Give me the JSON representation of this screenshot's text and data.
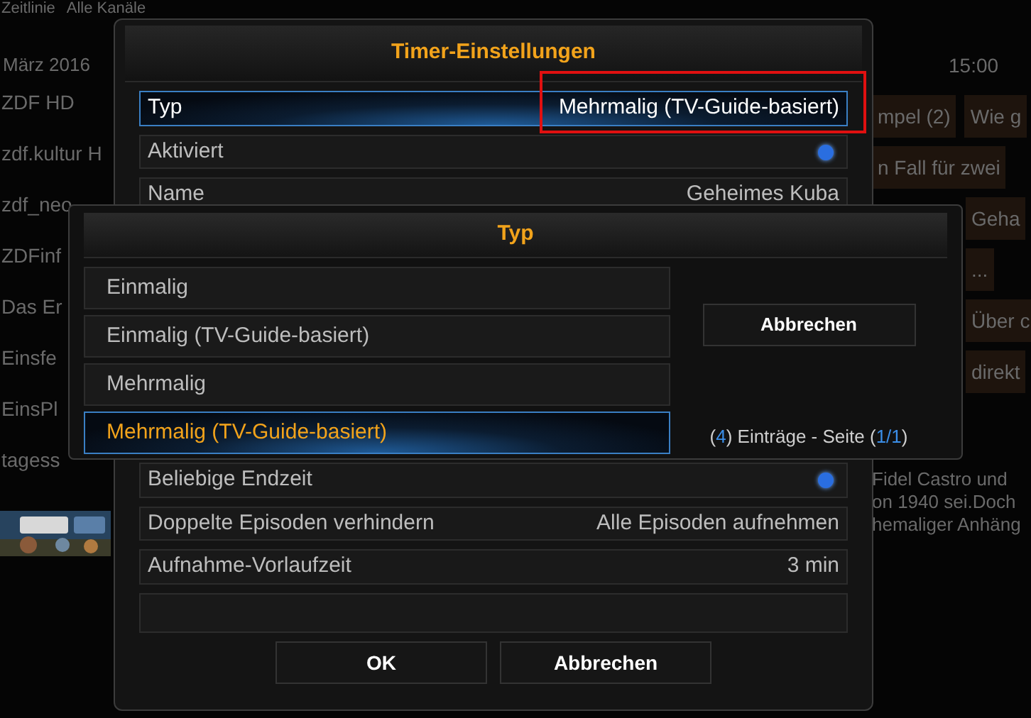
{
  "background": {
    "tabs": [
      "Zeitlinie",
      "Alle Kanäle"
    ],
    "date": "März 2016",
    "time": "15:00",
    "channels": [
      "ZDF HD",
      "zdf.kultur H",
      "zdf_neo",
      "ZDFinf",
      "Das Er",
      "Einsfe",
      "EinsPl",
      "tagess"
    ],
    "programmes": [
      [
        "mpel (2)",
        "Wie g"
      ],
      [
        "n Fall für zwei"
      ],
      [
        "Geha"
      ],
      [
        "..."
      ],
      [
        "Über c"
      ],
      [
        "direkt"
      ]
    ],
    "description": [
      "Fidel Castro und",
      "on 1940 sei.Doch",
      "hemaliger Anhäng"
    ],
    "thumbnail": {
      "kind": "picture"
    }
  },
  "timer_dialog": {
    "title": "Timer-Einstellungen",
    "rows": [
      {
        "kind": "value",
        "label": "Typ",
        "value": "Mehrmalig (TV-Guide-basiert)",
        "selected": true
      },
      {
        "kind": "toggle",
        "label": "Aktiviert",
        "on": true,
        "selected": false
      },
      {
        "kind": "value",
        "label": "Name",
        "value": "Geheimes Kuba",
        "selected": false
      }
    ],
    "rows_below": [
      {
        "kind": "toggle",
        "label": "Beliebige Endzeit",
        "on": true,
        "selected": false
      },
      {
        "kind": "value",
        "label": "Doppelte Episoden verhindern",
        "value": "Alle Episoden aufnehmen",
        "selected": false
      },
      {
        "kind": "value",
        "label": "Aufnahme-Vorlaufzeit",
        "value": "3 min",
        "selected": false
      }
    ],
    "buttons": [
      "OK",
      "Abbrechen"
    ]
  },
  "type_dialog": {
    "title": "Typ",
    "options": [
      {
        "label": "Einmalig",
        "selected": false
      },
      {
        "label": "Einmalig (TV-Guide-basiert)",
        "selected": false
      },
      {
        "label": "Mehrmalig",
        "selected": false
      },
      {
        "label": "Mehrmalig (TV-Guide-basiert)",
        "selected": true
      }
    ],
    "cancel": "Abbrechen",
    "footer": [
      {
        "text": "(",
        "highlighted": false
      },
      {
        "text": "4",
        "highlighted": true
      },
      {
        "text": ") Einträge - Seite (",
        "highlighted": false
      },
      {
        "text": "1/1",
        "highlighted": true
      },
      {
        "text": ")",
        "highlighted": false
      }
    ]
  }
}
